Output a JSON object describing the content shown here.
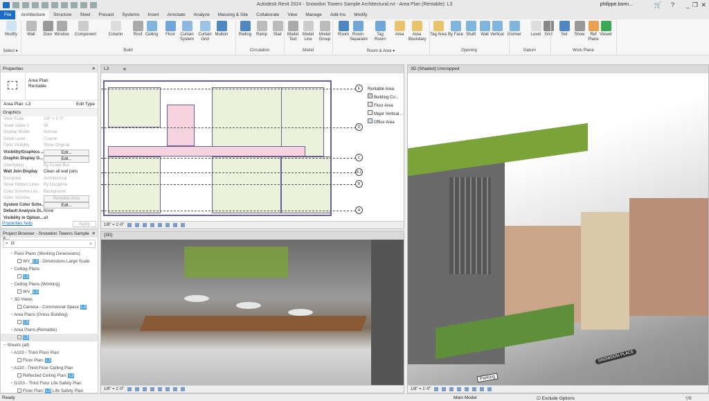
{
  "app": {
    "title": "Autodesk Revit 2024 - Snowdon Towers Sample Architectural.rvt - Area Plan (Rentable): L3",
    "user": "philippe.bonn...",
    "minimize": "_",
    "restore": "❐",
    "close": "✕"
  },
  "tabs": [
    "File",
    "Architecture",
    "Structure",
    "Steel",
    "Precast",
    "Systems",
    "Insert",
    "Annotate",
    "Analyze",
    "Massing & Site",
    "Collaborate",
    "View",
    "Manage",
    "Add-Ins",
    "Modify"
  ],
  "active_tab": "Architecture",
  "ribbon": {
    "tools": [
      {
        "label": "Modify",
        "color": "#cfe3f5"
      },
      {
        "label": "Wall",
        "color": "#bbb"
      },
      {
        "label": "Door",
        "color": "#999"
      },
      {
        "label": "Window",
        "color": "#aaa"
      },
      {
        "label": "Component",
        "color": "#ccc"
      },
      {
        "label": "Column",
        "color": "#ddd"
      },
      {
        "label": "Roof",
        "color": "#aaa"
      },
      {
        "label": "Ceiling",
        "color": "#7fb6e0"
      },
      {
        "label": "Floor",
        "color": "#6fa8d8"
      },
      {
        "label": "Curtain System",
        "color": "#8fb8e0"
      },
      {
        "label": "Curtain Grid",
        "color": "#9cc3e6"
      },
      {
        "label": "Mullion",
        "color": "#4f86c4"
      },
      {
        "label": "Railing",
        "color": "#4f86c4"
      },
      {
        "label": "Ramp",
        "color": "#bbb"
      },
      {
        "label": "Stair",
        "color": "#bbb"
      },
      {
        "label": "Model Text",
        "color": "#aaa"
      },
      {
        "label": "Model Line",
        "color": "#ccc"
      },
      {
        "label": "Model Group",
        "color": "#bbb"
      },
      {
        "label": "Room",
        "color": "#4f86c4"
      },
      {
        "label": "Room Separator",
        "color": "#6fa8d8"
      },
      {
        "label": "Tag Room",
        "color": "#6fa8d8"
      },
      {
        "label": "Area",
        "color": "#e9c46a"
      },
      {
        "label": "Area Boundary",
        "color": "#e9c46a"
      },
      {
        "label": "Tag Area",
        "color": "#e9c46a"
      },
      {
        "label": "By Face",
        "color": "#7fb6e0"
      },
      {
        "label": "Shaft",
        "color": "#7fb6e0"
      },
      {
        "label": "Wall",
        "color": "#7fb6e0"
      },
      {
        "label": "Vertical",
        "color": "#7fb6e0"
      },
      {
        "label": "Dormer",
        "color": "#7fb6e0"
      },
      {
        "label": "Level",
        "color": "#ddd"
      },
      {
        "label": "Grid",
        "color": "#888"
      },
      {
        "label": "Set",
        "color": "#4f86c4"
      },
      {
        "label": "Show",
        "color": "#999"
      },
      {
        "label": "Ref Plane",
        "color": "#e9a050"
      },
      {
        "label": "Viewer",
        "color": "#3aa855"
      }
    ],
    "groups": [
      "Select ▾",
      "Build",
      "Circulation",
      "Model",
      "Room & Area ▾",
      "Opening",
      "Datum",
      "Work Plane"
    ]
  },
  "properties": {
    "title": "Properties",
    "type_name": "Area Plan",
    "type_sub": "Rentable",
    "instance": "Area Plan: L3",
    "edit_type": "Edit Type",
    "section": "Graphics",
    "rows": [
      {
        "k": "View Scale",
        "v": "1/8\" = 1'-0\"",
        "s": "dim"
      },
      {
        "k": "Scale Value  1:",
        "v": "96",
        "s": "dim"
      },
      {
        "k": "Display Model",
        "v": "Normal",
        "s": "dim"
      },
      {
        "k": "Detail Level",
        "v": "Coarse",
        "s": "dim"
      },
      {
        "k": "Parts Visibility",
        "v": "Show Original",
        "s": "dim"
      },
      {
        "k": "Visibility/Graphics ...",
        "v": "Edit...",
        "s": "btn"
      },
      {
        "k": "Graphic Display O...",
        "v": "Edit...",
        "s": "btn"
      },
      {
        "k": "Orientation",
        "v": "By Scope Box",
        "s": "dim"
      },
      {
        "k": "Wall Join Display",
        "v": "Clean all wall joins",
        "s": "bold"
      },
      {
        "k": "Discipline",
        "v": "Architectural",
        "s": "dim"
      },
      {
        "k": "Show Hidden Lines",
        "v": "By Discipline",
        "s": "dim"
      },
      {
        "k": "Color Scheme Loc...",
        "v": "Background",
        "s": "dim"
      },
      {
        "k": "Color Scheme",
        "v": "Rentable Area",
        "s": "dimbtn"
      },
      {
        "k": "System Color Sche...",
        "v": "Edit...",
        "s": "btn"
      },
      {
        "k": "Default Analysis Di...",
        "v": "None",
        "s": "bold"
      },
      {
        "k": "Visibility in Option...",
        "v": "all",
        "s": "bold"
      }
    ],
    "help": "Properties help",
    "apply": "Apply"
  },
  "browser": {
    "title": "Project Browser - Snowdon Towers Sample A...",
    "search": "l3",
    "items": [
      {
        "t": "Floor Plans (Working Dimensions)",
        "lvl": 1
      },
      {
        "t": "WV_",
        "hl": "L3",
        "after": " - Dimensions Large Scale",
        "lvl": 2
      },
      {
        "t": "Ceiling Plans",
        "lvl": 1
      },
      {
        "t": "",
        "hl": "L3",
        "after": "",
        "lvl": 2
      },
      {
        "t": "Ceiling Plans (Working)",
        "lvl": 1
      },
      {
        "t": "WV_",
        "hl": "L3",
        "after": "",
        "lvl": 2
      },
      {
        "t": "3D Views",
        "lvl": 1
      },
      {
        "t": "Camera - Commercial Space ",
        "hl": "L3",
        "after": "",
        "lvl": 2
      },
      {
        "t": "Area Plans (Gross Building)",
        "lvl": 1
      },
      {
        "t": "",
        "hl": "L3",
        "after": "",
        "lvl": 2
      },
      {
        "t": "Area Plans (Rentable)",
        "lvl": 1
      },
      {
        "t": "",
        "hl": "L3",
        "after": "",
        "lvl": 2
      },
      {
        "t": "Sheets (all)",
        "lvl": 0
      },
      {
        "t": "A103 - Third Floor Plan",
        "lvl": 1
      },
      {
        "t": "Floor Plan: ",
        "hl": "L3",
        "after": "",
        "lvl": 2
      },
      {
        "t": "A110 - Third Floor Ceiling Plan",
        "lvl": 1
      },
      {
        "t": "Reflected Ceiling Plan: ",
        "hl": "L3",
        "after": "",
        "lvl": 2
      },
      {
        "t": "G103 - Third Floor Life Safety Plan",
        "lvl": 1
      },
      {
        "t": "Floor Plan: ",
        "hl": "L3",
        "after": " Life Safety Plan",
        "lvl": 2
      }
    ]
  },
  "views": {
    "plan": {
      "tab": "L3",
      "scale": "1/8\" = 1'-0\"",
      "legend_title": "Rentable Area",
      "legend": [
        {
          "t": "Building Co...",
          "c": "#d8d0d8"
        },
        {
          "t": "Floor Area",
          "c": "#f0e0e8"
        },
        {
          "t": "Major Vertical...",
          "c": "#eaf3d9"
        },
        {
          "t": "Office Area",
          "c": "#cfe8f0"
        }
      ],
      "grids": [
        "E",
        "D",
        "C",
        "B.1",
        "B",
        "A"
      ]
    },
    "interior": {
      "tab": "{3D}",
      "scale": "1/8\" = 1'-0\""
    },
    "exterior": {
      "tab": "3D (Shaded) Uncropped",
      "scale": "1/8\" = 1'-0\"",
      "signs": [
        "Parking",
        "SNOWDON PLACE"
      ]
    }
  },
  "status": {
    "ready": "Ready",
    "model": "Main Model",
    "exclude": "Exclude Options",
    "filter_count": "0"
  }
}
